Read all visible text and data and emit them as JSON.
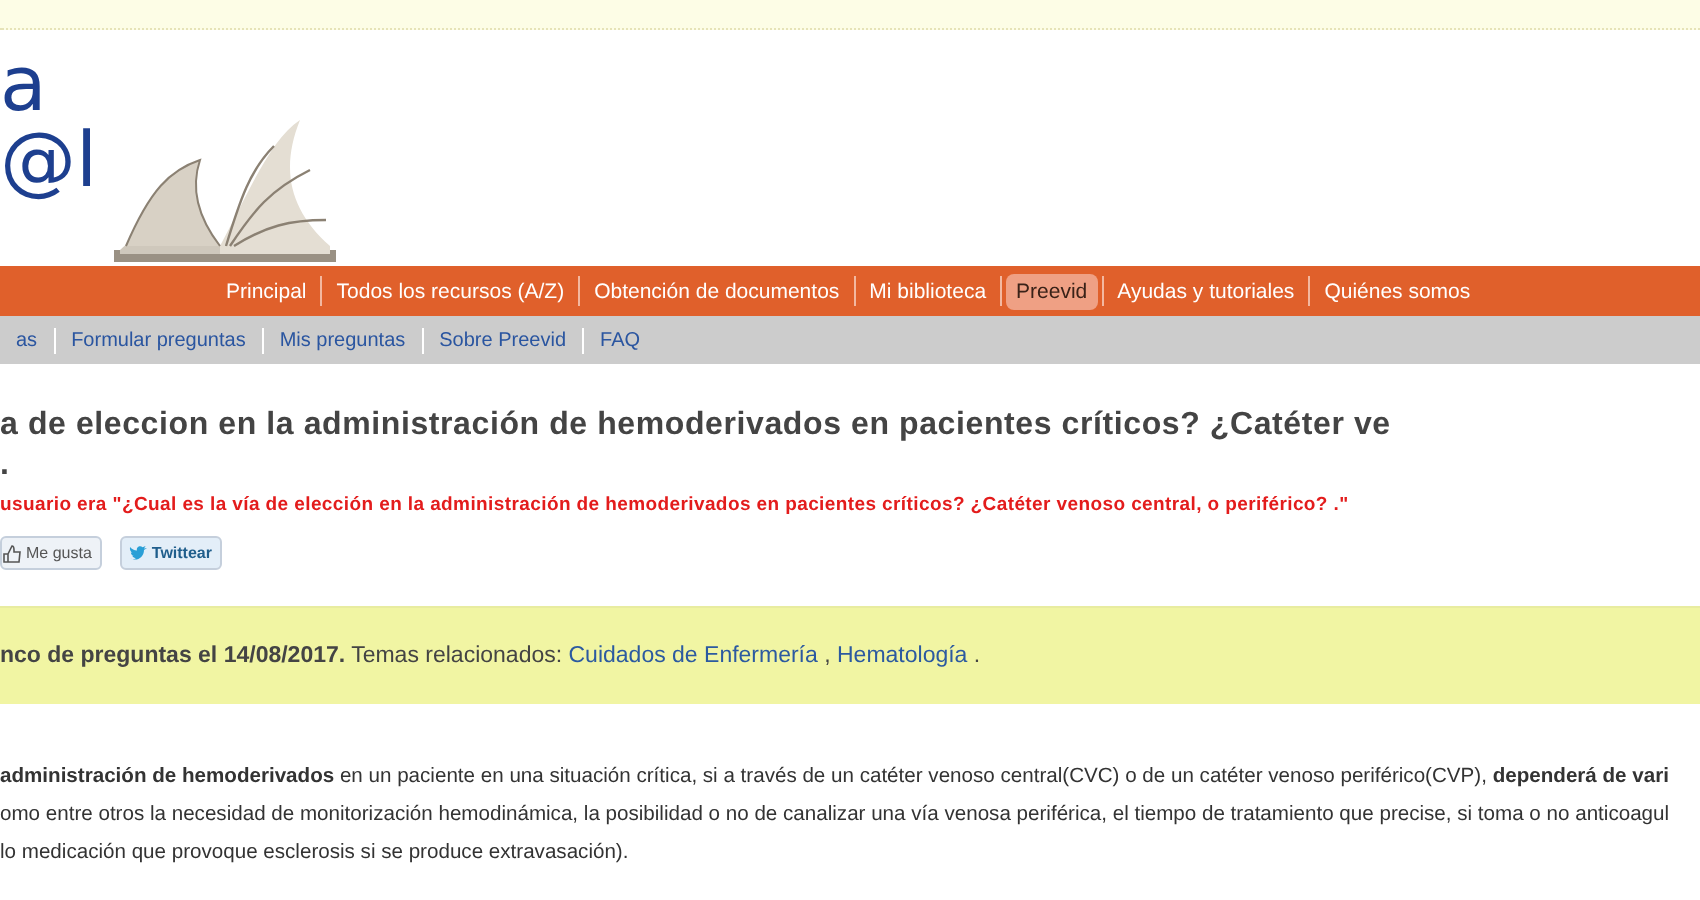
{
  "logo": {
    "lines": [
      "a",
      "@l"
    ]
  },
  "main_nav": [
    {
      "label": "Principal",
      "selected": false
    },
    {
      "label": "Todos los recursos (A/Z)",
      "selected": false
    },
    {
      "label": "Obtención de documentos",
      "selected": false
    },
    {
      "label": "Mi biblioteca",
      "selected": false
    },
    {
      "label": "Preevid",
      "selected": true
    },
    {
      "label": "Ayudas y tutoriales",
      "selected": false
    },
    {
      "label": "Quiénes somos",
      "selected": false
    }
  ],
  "sub_nav": [
    "as",
    "Formular preguntas",
    "Mis preguntas",
    "Sobre Preevid",
    "FAQ"
  ],
  "title_lines": [
    "a de eleccion en la administración de hemoderivados en pacientes críticos? ¿Catéter ve",
    "."
  ],
  "user_question": "usuario era \"¿Cual es la vía de elección en la administración de hemoderivados en pacientes críticos? ¿Catéter venoso central, o periférico? .\"",
  "share_buttons": [
    {
      "kind": "like",
      "label": "Me gusta"
    },
    {
      "kind": "tweet",
      "label": "Twittear"
    }
  ],
  "info_box": {
    "text": "**nco de preguntas el 14/08/2017.** Temas relacionados: ",
    "topics": [
      "Cuidados de Enfermería",
      "Hematología"
    ],
    "separator": " , ",
    "end": " ."
  },
  "body_lines": [
    "**administración de hemoderivados** en un paciente en una situación crítica, si a través de un catéter venoso central(CVC) o de un catéter venoso periférico(CVP), **dependerá de vari**",
    "omo entre otros la necesidad de monitorización hemodinámica, la posibilidad o no de canalizar una vía venosa periférica, el tiempo de tratamiento que precise, si toma o no anticoagul",
    "lo medicación que provoque esclerosis si se produce extravasación)."
  ]
}
